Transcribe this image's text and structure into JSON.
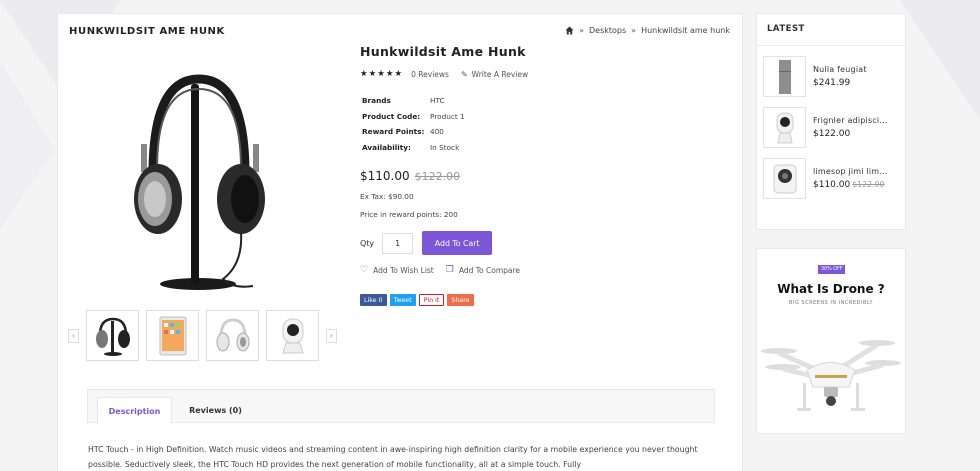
{
  "panel_title": "HUNKWILDSIT AME HUNK",
  "breadcrumb": {
    "home_icon": "home-icon",
    "items": [
      "Desktops",
      "Hunkwildsit ame hunk"
    ]
  },
  "product": {
    "title": "Hunkwildsit Ame Hunk",
    "stars": "★★★★★",
    "reviews_link": "0 Reviews",
    "write_review": "Write A Review",
    "specs": [
      {
        "key": "Brands",
        "value": "HTC"
      },
      {
        "key": "Product Code:",
        "value": "Product 1"
      },
      {
        "key": "Reward Points:",
        "value": "400"
      },
      {
        "key": "Availability:",
        "value": "In Stock"
      }
    ],
    "price_new": "$110.00",
    "price_old": "$122.00",
    "ex_tax": "Ex Tax: $90.00",
    "reward_price": "Price in reward points: 200",
    "qty_label": "Qty",
    "qty_value": "1",
    "add_to_cart": "Add To Cart",
    "wishlist": "Add To Wish List",
    "compare": "Add To Compare",
    "share": {
      "facebook": "Like 0",
      "twitter": "Tweet",
      "pinterest": "Pin it",
      "share": "Share"
    }
  },
  "tabs": [
    "Description",
    "Reviews (0)"
  ],
  "description": "HTC Touch - in High Definition. Watch music videos and streaming content in awe-inspiring high definition clarity for a mobile experience you never thought possible. Seductively sleek, the HTC Touch HD provides the next generation of mobile functionality, all at a simple touch. Fully",
  "latest": {
    "title": "LATEST",
    "items": [
      {
        "name": "Nulla feugiat",
        "price": "$241.99",
        "old_price": ""
      },
      {
        "name": "Frignler adipisci...",
        "price": "$122.00",
        "old_price": ""
      },
      {
        "name": "limesop jimi lim...",
        "price": "$110.00",
        "old_price": "$122.00"
      }
    ]
  },
  "banner": {
    "badge": "30% OFF",
    "title": "What Is Drone ?",
    "subtitle": "BIG SCREENS IN INCREDIBLY"
  },
  "colors": {
    "accent": "#7b57d8",
    "facebook": "#3b5998",
    "twitter": "#1da1f2",
    "pinterest": "#cb2027",
    "share": "#f06d4b"
  }
}
